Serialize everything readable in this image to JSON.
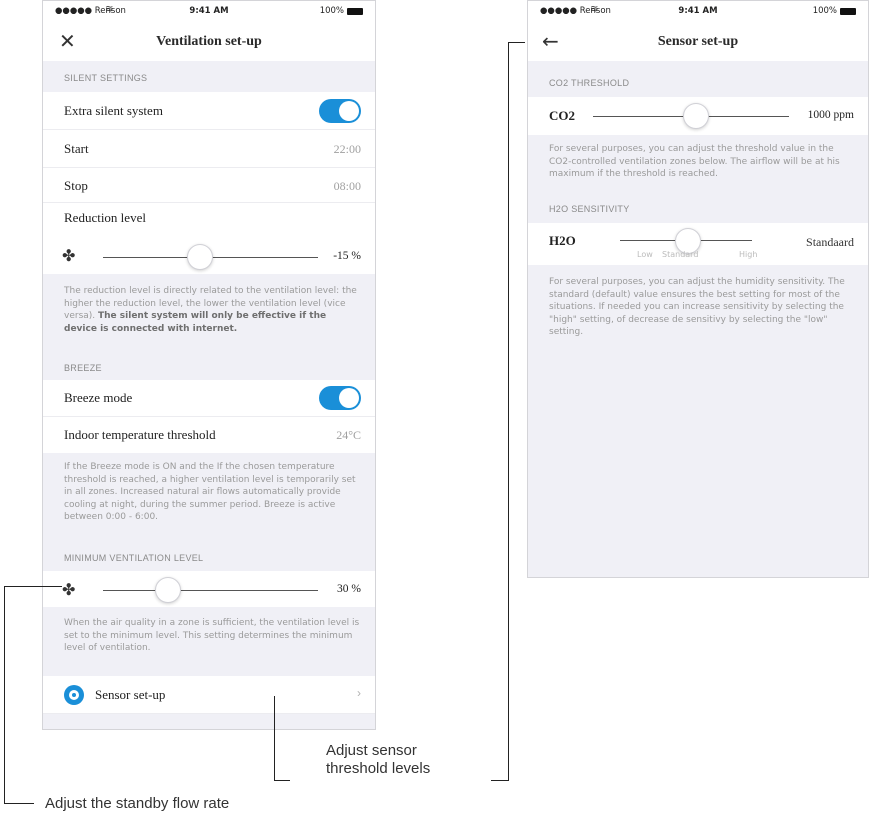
{
  "status_bar": {
    "carrier": "●●●●● Renson",
    "time": "9:41 AM",
    "battery": "100%"
  },
  "ventilation_screen": {
    "title": "Ventilation set-up",
    "silent_header": "SILENT SETTINGS",
    "extra_silent_label": "Extra silent system",
    "extra_silent_on": true,
    "start_label": "Start",
    "start_value": "22:00",
    "stop_label": "Stop",
    "stop_value": "08:00",
    "reduction_label": "Reduction level",
    "reduction_value": "-15 %",
    "reduction_fraction": 0.45,
    "reduction_desc_plain": "The reduction level is directly related to the ventilation level: the higher the reduction level, the lower the ventilation level (vice versa). ",
    "reduction_desc_bold": "The silent system will only be effective if the device is connected with internet.",
    "breeze_header": "BREEZE",
    "breeze_label": "Breeze mode",
    "breeze_on": true,
    "indoor_label": "Indoor temperature threshold",
    "indoor_value": "24°C",
    "breeze_desc": "If the Breeze mode is ON and the If the chosen temperature threshold is reached, a higher ventilation level is temporarily set in all zones. Increased natural air flows automatically provide cooling at night, during the summer period. Breeze is active between 0:00 - 6:00.",
    "min_header": "MINIMUM VENTILATION LEVEL",
    "min_value": "30 %",
    "min_fraction": 0.3,
    "min_desc": "When the air quality in a zone is sufficient, the ventilation level is set to the minimum level. This setting determines the minimum level of ventilation.",
    "sensor_label": "Sensor set-up",
    "chevron": "›"
  },
  "sensor_screen": {
    "title": "Sensor set-up",
    "co2_header": "CO2 THRESHOLD",
    "co2_label": "CO2",
    "co2_value": "1000 ppm",
    "co2_desc": "For several purposes, you can adjust the threshold value in the CO2-controlled ventilation zones below. The airflow will be at his maximum if the threshold is reached.",
    "h2o_header": "H2O SENSITIVITY",
    "h2o_label": "H2O",
    "h2o_value": "Standaard",
    "h2o_ticks": [
      "Low",
      "Standard",
      "High"
    ],
    "h2o_desc": "For several purposes, you can adjust the humidity sensitivity. The standard (default) value ensures the best setting for most of the situations. If needed you can increase sensitivity by selecting the \"high\" setting, of decrease de sensitivy by selecting the \"low\" setting."
  },
  "icons": {
    "close": "close-icon",
    "back": "back-arrow-icon",
    "fan": "fan-icon",
    "sensor": "sensor-target-icon",
    "wifi": "wifi-icon"
  },
  "colors": {
    "accent": "#1a8fd8",
    "background": "#f0f0f6"
  },
  "callouts": {
    "sensor": [
      "Adjust sensor",
      "threshold levels"
    ],
    "standby": "Adjust the standby flow rate"
  }
}
